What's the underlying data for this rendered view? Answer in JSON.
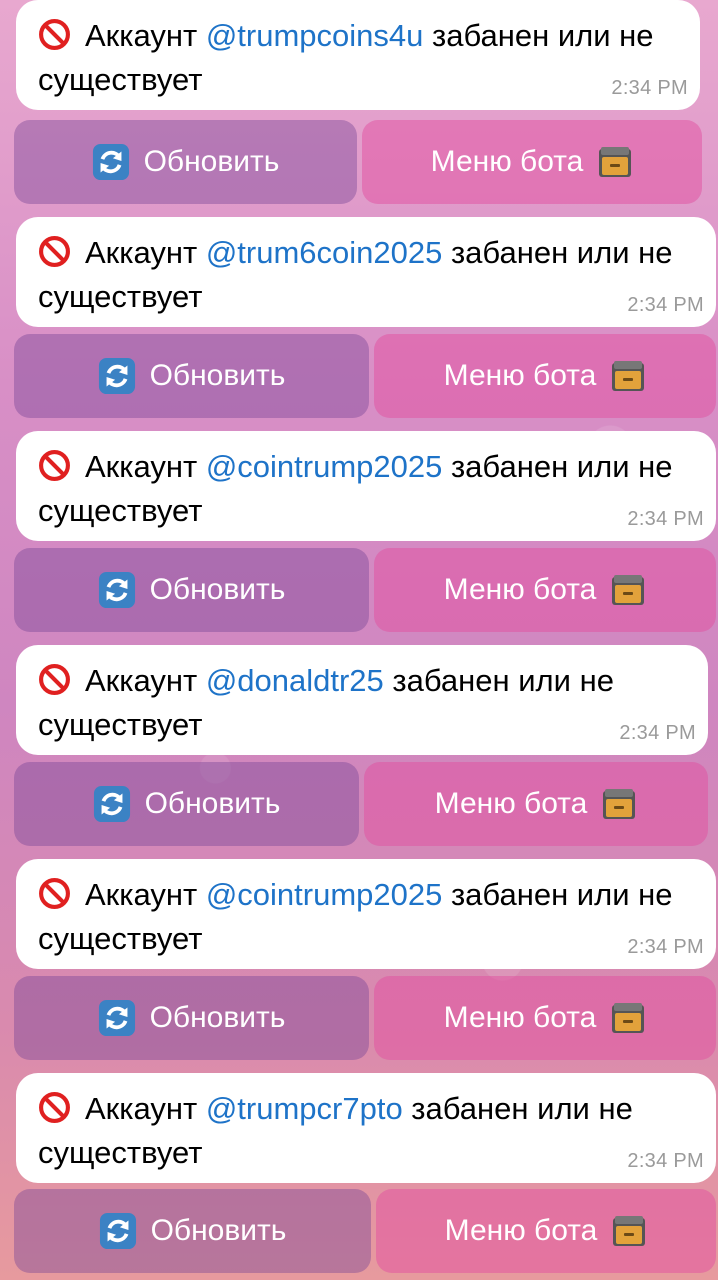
{
  "messages": [
    {
      "prefix": "Аккаунт ",
      "handle": "@trumpcoins4u",
      "suffix": " забанен или не существует",
      "time": "2:34 PM",
      "refresh_label": "Обновить",
      "menu_label": "Меню бота"
    },
    {
      "prefix": "Аккаунт ",
      "handle": "@trum6coin2025",
      "suffix": " забанен или не существует",
      "time": "2:34 PM",
      "refresh_label": "Обновить",
      "menu_label": "Меню бота"
    },
    {
      "prefix": "Аккаунт ",
      "handle": "@cointrump2025",
      "suffix": " забанен или не существует",
      "time": "2:34 PM",
      "refresh_label": "Обновить",
      "menu_label": "Меню бота"
    },
    {
      "prefix": "Аккаунт ",
      "handle": "@donaldtr25",
      "suffix": " забанен или не существует",
      "time": "2:34 PM",
      "refresh_label": "Обновить",
      "menu_label": "Меню бота"
    },
    {
      "prefix": "Аккаунт ",
      "handle": "@cointrump2025",
      "suffix": " забанен или не существует",
      "time": "2:34 PM",
      "refresh_label": "Обновить",
      "menu_label": "Меню бота"
    },
    {
      "prefix": "Аккаунт ",
      "handle": "@trumpcr7pto",
      "suffix": " забанен или не существует",
      "time": "2:34 PM",
      "refresh_label": "Обновить",
      "menu_label": "Меню бота"
    }
  ],
  "icons": {
    "status": "no-entry-icon",
    "refresh": "refresh-arrows-icon",
    "menu": "file-cabinet-icon"
  },
  "colors": {
    "handle_link": "#1e73c8",
    "ban_red": "#e02020",
    "refresh_blue": "#3b82c4"
  }
}
